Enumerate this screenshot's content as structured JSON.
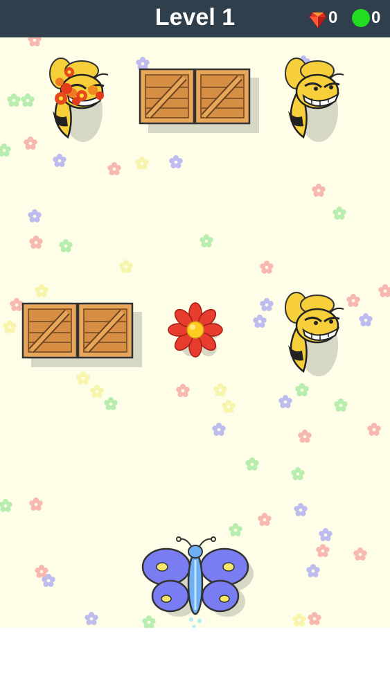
{
  "header": {
    "title": "Level 1",
    "gem_count": "0",
    "dot_count": "0",
    "gem_icon": "red-gem-icon",
    "dot_icon": "green-dot-icon"
  },
  "colors": {
    "header_bg": "#2f3f4c",
    "field_bg": "#fdfde8",
    "counter_dot": "#22dd22",
    "crate": "#e8a65a",
    "bee_yellow": "#f6cf3a",
    "butterfly": "#7a7cf2",
    "flower_red": "#e83c2e"
  },
  "entities": {
    "bees": 3,
    "crates": 2,
    "flowers": 1,
    "player": "butterfly"
  }
}
